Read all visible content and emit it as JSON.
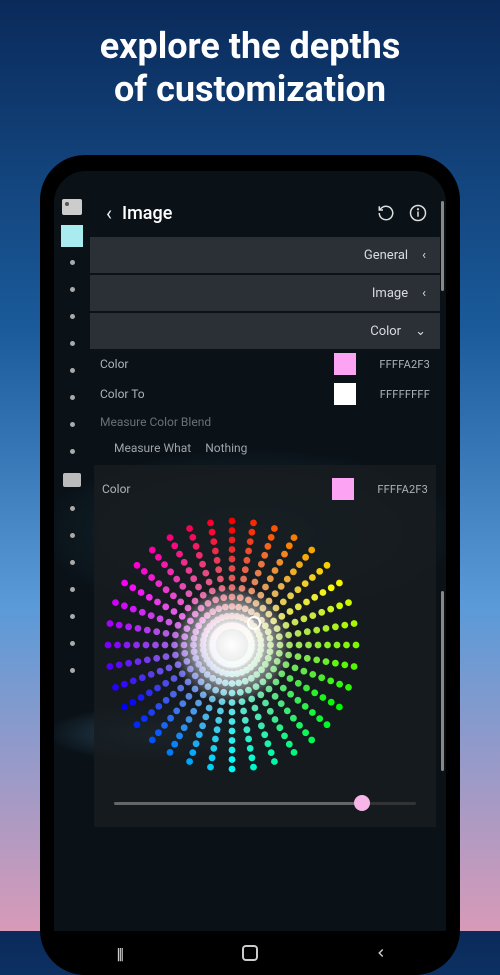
{
  "hero": {
    "line1": "explore the depths",
    "line2": "of customization"
  },
  "header": {
    "title": "Image"
  },
  "sections": {
    "general": {
      "label": "General",
      "chevron": "‹"
    },
    "image": {
      "label": "Image",
      "chevron": "‹"
    },
    "color": {
      "label": "Color",
      "chevron": "⌄"
    }
  },
  "props": {
    "color": {
      "label": "Color",
      "value": "FFFFA2F3",
      "swatch": "#fca4f3"
    },
    "colorTo": {
      "label": "Color To",
      "value": "FFFFFFFF",
      "swatch": "#ffffff"
    },
    "measureBlend": {
      "label": "Measure Color Blend"
    },
    "measureWhat": {
      "label": "Measure What",
      "value": "Nothing"
    }
  },
  "picker": {
    "label": "Color",
    "value": "FFFFA2F3",
    "swatch": "#fca4f3"
  }
}
